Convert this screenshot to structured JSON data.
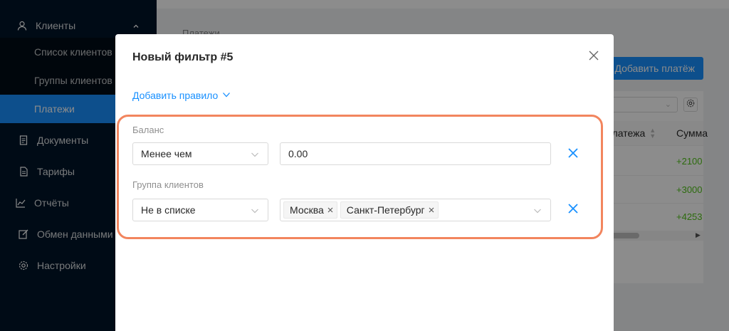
{
  "sidebar": {
    "group_clients": "Клиенты",
    "sub_items": [
      "Список клиентов",
      "Группы клиентов",
      "Платежи"
    ],
    "items": [
      "Документы",
      "Тарифы",
      "Отчёты",
      "Обмен данными",
      "Настройки"
    ]
  },
  "main": {
    "breadcrumb": "Платежи",
    "add_payment_button": "Добавить платёж",
    "col_payment": "платежа",
    "col_amount": "Сумма",
    "amounts": [
      "+2100",
      "+3000",
      "+4253"
    ]
  },
  "modal": {
    "title": "Новый фильтр #5",
    "add_rule": "Добавить правило",
    "rules": [
      {
        "label": "Баланс",
        "operator": "Менее чем",
        "value": "0.00"
      },
      {
        "label": "Группа клиентов",
        "operator": "Не в списке",
        "tags": [
          "Москва",
          "Санкт-Петербург"
        ]
      }
    ]
  },
  "colors": {
    "accent": "#1890ff",
    "sidebar_bg": "#001529",
    "highlight": "#f2855e",
    "positive": "#52c41a"
  }
}
